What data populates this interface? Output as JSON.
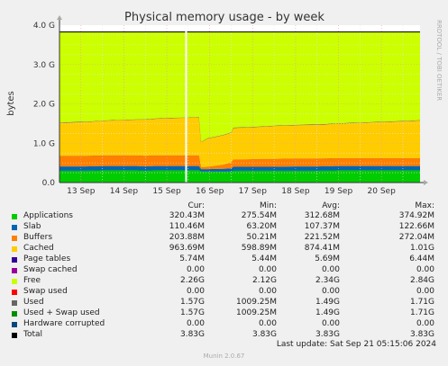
{
  "chart_data": {
    "type": "area",
    "title": "Physical memory usage - by week",
    "ylabel": "bytes",
    "side_label": "RRDTOOL / TOBI OETIKER",
    "ylim": [
      0,
      4.0
    ],
    "yticks": [
      "0.0",
      "1.0 G",
      "2.0 G",
      "3.0 G",
      "4.0 G"
    ],
    "ytick_values": [
      0,
      1,
      2,
      3,
      4
    ],
    "xticks": [
      "13 Sep",
      "14 Sep",
      "15 Sep",
      "16 Sep",
      "17 Sep",
      "18 Sep",
      "19 Sep",
      "20 Sep"
    ],
    "xtick_positions": [
      0.5,
      1.5,
      2.5,
      3.5,
      4.5,
      5.5,
      6.5,
      7.5
    ],
    "x": [
      0,
      0.3,
      0.6,
      1.0,
      1.4,
      1.8,
      2.0,
      2.2,
      2.6,
      3.0,
      3.25,
      3.3,
      3.45,
      3.8,
      4.0,
      4.05,
      4.3,
      4.7,
      5.0,
      5.5,
      6.0,
      6.5,
      7.0,
      7.5,
      8.0,
      8.4
    ],
    "series": [
      {
        "name": "Applications",
        "color": "#00cc00",
        "values": [
          0.3,
          0.3,
          0.3,
          0.31,
          0.31,
          0.31,
          0.3,
          0.31,
          0.31,
          0.31,
          0.31,
          0.28,
          0.28,
          0.28,
          0.28,
          0.3,
          0.3,
          0.3,
          0.3,
          0.3,
          0.3,
          0.31,
          0.31,
          0.31,
          0.31,
          0.31
        ]
      },
      {
        "name": "Slab",
        "color": "#0066b3",
        "values": [
          0.11,
          0.11,
          0.11,
          0.11,
          0.11,
          0.11,
          0.11,
          0.11,
          0.11,
          0.11,
          0.11,
          0.06,
          0.06,
          0.07,
          0.08,
          0.1,
          0.1,
          0.1,
          0.1,
          0.11,
          0.11,
          0.11,
          0.11,
          0.11,
          0.11,
          0.11
        ]
      },
      {
        "name": "Buffers",
        "color": "#ff8000",
        "values": [
          0.27,
          0.27,
          0.27,
          0.27,
          0.27,
          0.27,
          0.27,
          0.27,
          0.27,
          0.27,
          0.27,
          0.05,
          0.06,
          0.1,
          0.15,
          0.19,
          0.19,
          0.2,
          0.2,
          0.2,
          0.2,
          0.2,
          0.2,
          0.2,
          0.2,
          0.2
        ]
      },
      {
        "name": "Cached",
        "color": "#ffcc00",
        "values": [
          0.84,
          0.85,
          0.86,
          0.88,
          0.9,
          0.91,
          0.92,
          0.93,
          0.95,
          0.96,
          0.97,
          0.64,
          0.72,
          0.75,
          0.76,
          0.8,
          0.81,
          0.82,
          0.84,
          0.85,
          0.86,
          0.88,
          0.9,
          0.92,
          0.94,
          0.96
        ]
      },
      {
        "name": "Page tables",
        "color": "#330099",
        "values": [
          0.006
        ]
      },
      {
        "name": "Swap cached",
        "color": "#990099",
        "values": [
          0
        ]
      },
      {
        "name": "Free",
        "color": "#ccff00",
        "values": [
          2.3,
          2.29,
          2.28,
          2.25,
          2.23,
          2.22,
          2.22,
          2.2,
          2.18,
          2.17,
          2.16,
          2.79,
          2.7,
          2.62,
          2.55,
          2.43,
          2.42,
          2.4,
          2.38,
          2.36,
          2.35,
          2.32,
          2.3,
          2.28,
          2.26,
          2.24
        ]
      },
      {
        "name": "Swap used",
        "color": "#ff0000",
        "values": [
          0
        ]
      },
      {
        "name": "Used",
        "color": "#666666",
        "values": []
      },
      {
        "name": "Used + Swap used",
        "color": "#008f00",
        "values": []
      },
      {
        "name": "Hardware corrupted",
        "color": "#00487d",
        "values": []
      },
      {
        "name": "Total",
        "color": "#000000",
        "value": 3.83
      }
    ],
    "restart_marker_x": 2.95
  },
  "legend": {
    "headers": {
      "cur": "Cur:",
      "min": "Min:",
      "avg": "Avg:",
      "max": "Max:"
    },
    "rows": [
      {
        "label": "Applications",
        "color": "#00cc00",
        "cur": "320.43M",
        "min": "275.54M",
        "avg": "312.68M",
        "max": "374.92M"
      },
      {
        "label": "Slab",
        "color": "#0066b3",
        "cur": "110.46M",
        "min": "63.20M",
        "avg": "107.37M",
        "max": "122.66M"
      },
      {
        "label": "Buffers",
        "color": "#ff8000",
        "cur": "203.88M",
        "min": "50.21M",
        "avg": "221.52M",
        "max": "272.04M"
      },
      {
        "label": "Cached",
        "color": "#ffcc00",
        "cur": "963.69M",
        "min": "598.89M",
        "avg": "874.41M",
        "max": "1.01G"
      },
      {
        "label": "Page tables",
        "color": "#330099",
        "cur": "5.74M",
        "min": "5.44M",
        "avg": "5.69M",
        "max": "6.44M"
      },
      {
        "label": "Swap cached",
        "color": "#990099",
        "cur": "0.00",
        "min": "0.00",
        "avg": "0.00",
        "max": "0.00"
      },
      {
        "label": "Free",
        "color": "#ccff00",
        "cur": "2.26G",
        "min": "2.12G",
        "avg": "2.34G",
        "max": "2.84G"
      },
      {
        "label": "Swap used",
        "color": "#ff0000",
        "cur": "0.00",
        "min": "0.00",
        "avg": "0.00",
        "max": "0.00"
      },
      {
        "label": "Used",
        "color": "#666666",
        "cur": "1.57G",
        "min": "1009.25M",
        "avg": "1.49G",
        "max": "1.71G"
      },
      {
        "label": "Used + Swap used",
        "color": "#008f00",
        "cur": "1.57G",
        "min": "1009.25M",
        "avg": "1.49G",
        "max": "1.71G"
      },
      {
        "label": "Hardware corrupted",
        "color": "#00487d",
        "cur": "0.00",
        "min": "0.00",
        "avg": "0.00",
        "max": "0.00"
      },
      {
        "label": "Total",
        "color": "#000000",
        "cur": "3.83G",
        "min": "3.83G",
        "avg": "3.83G",
        "max": "3.83G"
      }
    ]
  },
  "footer": {
    "last_update": "Last update: Sat Sep 21 05:15:06 2024",
    "version": "Munin 2.0.67"
  }
}
